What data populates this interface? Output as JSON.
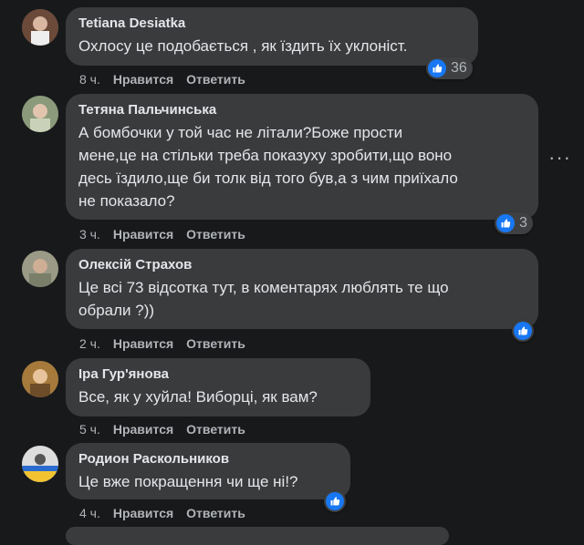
{
  "comments": [
    {
      "author": "Tetiana Desiatka",
      "text": "Охлосу це подобається , як їздить їх уклоніст.",
      "time": "8 ч.",
      "like_label": "Нравится",
      "reply_label": "Ответить",
      "reactions": "36"
    },
    {
      "author": "Тетяна Пальчинська",
      "text_lines": [
        "А бомбочки у той час не літали?Боже прости",
        "мене,це на стільки треба показуху зробити,що воно",
        "десь їздило,ще би толк від того був,а з чим приїхало",
        "не показало?"
      ],
      "time": "3 ч.",
      "like_label": "Нравится",
      "reply_label": "Ответить",
      "reactions": "3",
      "more": "···"
    },
    {
      "author": "Олексій Страхов",
      "text_lines": [
        "Це всі 73 відсотка тут, в коментарях люблять те що",
        "обрали ?))"
      ],
      "time": "2 ч.",
      "like_label": "Нравится",
      "reply_label": "Ответить"
    },
    {
      "author": "Іра Гур'янова",
      "text": "Все, як у хуйла! Виборці, як вам?",
      "time": "5 ч.",
      "like_label": "Нравится",
      "reply_label": "Ответить"
    },
    {
      "author": "Родион Раскольников",
      "text": "Це вже покращення чи ще ні!?",
      "time": "4 ч.",
      "like_label": "Нравится",
      "reply_label": "Ответить"
    }
  ],
  "colors": {
    "background": "#18191a",
    "bubble": "#3a3b3c",
    "like_blue": "#1877f2",
    "secondary_text": "#b0b3b8"
  }
}
